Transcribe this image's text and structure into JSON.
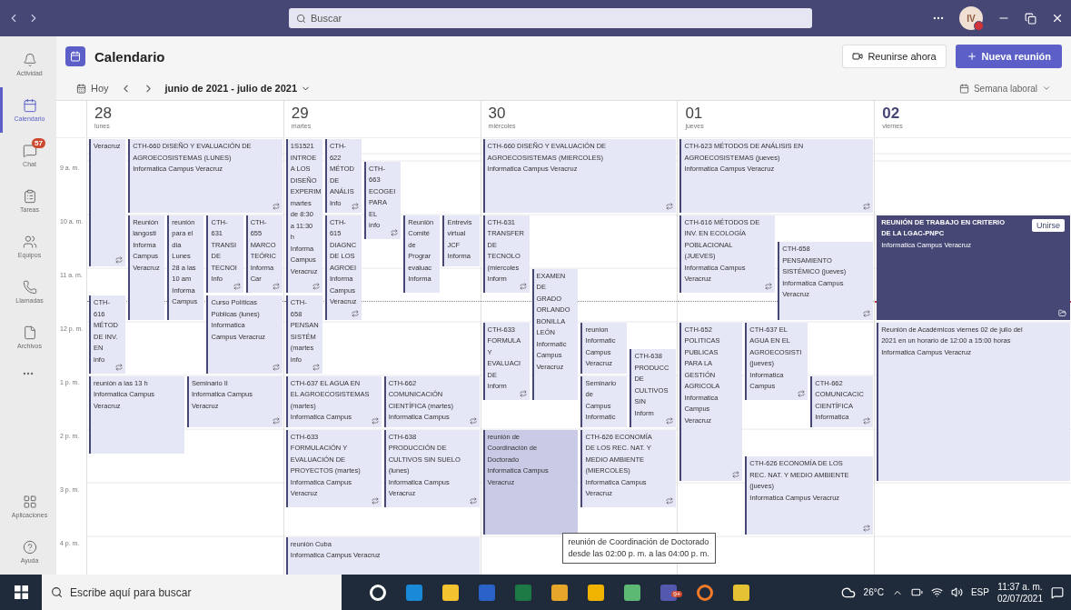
{
  "titlebar": {
    "search_placeholder": "Buscar",
    "avatar_initials": "IV"
  },
  "rail": {
    "items": [
      {
        "label": "Actividad",
        "selected": false
      },
      {
        "label": "Calendario",
        "selected": true
      },
      {
        "label": "Chat",
        "selected": false,
        "badge": "57"
      },
      {
        "label": "Tareas",
        "selected": false
      },
      {
        "label": "Equipos",
        "selected": false
      },
      {
        "label": "Llamadas",
        "selected": false
      },
      {
        "label": "Archivos",
        "selected": false
      }
    ],
    "bottom_items": [
      {
        "label": "Aplicaciones",
        "selected": false
      },
      {
        "label": "Ayuda",
        "selected": false
      }
    ]
  },
  "header": {
    "title": "Calendario",
    "meet_now": "Reunirse ahora",
    "new_meeting": "Nueva reunión"
  },
  "toolbar": {
    "today": "Hoy",
    "range": "junio de 2021 - julio de 2021",
    "view": "Semana laboral"
  },
  "time_labels": [
    "9 a. m.",
    "10 a. m.",
    "11 a. m.",
    "12 p. m.",
    "1 p. m.",
    "2 p. m.",
    "3 p. m.",
    "4 p. m."
  ],
  "days": [
    {
      "number": "28",
      "weekday": "lunes",
      "today": false,
      "events": [
        {
          "kind": "normal",
          "repeat": true,
          "lines": [
            "Veracruz"
          ]
        },
        {
          "kind": "normal",
          "repeat": true,
          "lines": [
            "CTH-660 DISEÑO Y EVALUACIÓN DE",
            "AGROECOSISTEMAS (LUNES)",
            "Informatica Campus Veracruz"
          ]
        },
        {
          "kind": "normal",
          "repeat": false,
          "lines": [
            "Reunión",
            "langosti",
            "Informa",
            "Campus",
            "Veracruz"
          ]
        },
        {
          "kind": "normal",
          "repeat": false,
          "lines": [
            "reunión",
            "para el",
            "dia",
            "Lunes",
            "28 a las",
            "10 am",
            "Informa",
            "Campus"
          ]
        },
        {
          "kind": "normal",
          "repeat": true,
          "lines": [
            "CTH-",
            "631",
            "TRANSI",
            "DE",
            "TECNOI",
            "Info"
          ]
        },
        {
          "kind": "normal",
          "repeat": true,
          "lines": [
            "CTH-",
            "655",
            "MARCO",
            "TEÓRIC",
            "Informa",
            "Car"
          ]
        },
        {
          "kind": "normal",
          "repeat": true,
          "lines": [
            "CTH-",
            "616",
            "MÉTOD",
            "DE INV.",
            "EN",
            "info"
          ]
        },
        {
          "kind": "normal",
          "repeat": true,
          "lines": [
            "Curso Políticas",
            "Públicas (lunes)",
            "Informatica",
            "Campus Veracruz"
          ]
        },
        {
          "kind": "normal",
          "repeat": false,
          "lines": [
            "reunión a las 13 h",
            "Informatica Campus",
            "Veracruz"
          ]
        },
        {
          "kind": "normal",
          "repeat": true,
          "lines": [
            "Seminario II",
            "Informatica Campus",
            "Veracruz"
          ]
        }
      ]
    },
    {
      "number": "29",
      "weekday": "martes",
      "today": false,
      "events": [
        {
          "kind": "normal",
          "repeat": true,
          "lines": [
            "1S1521",
            "INTROE",
            "A LOS",
            "DISEÑO",
            "EXPERIM",
            "martes",
            "de 8:30",
            "a 11:30",
            "h",
            "Informa",
            "Campus",
            "Veracruz"
          ]
        },
        {
          "kind": "normal",
          "repeat": true,
          "lines": [
            "CTH-",
            "622",
            "MÉTOD",
            "DE",
            "ANÁLIS",
            "Info"
          ]
        },
        {
          "kind": "normal",
          "repeat": true,
          "lines": [
            "CTH-",
            "663",
            "ECOGEI",
            "PARA",
            "EL",
            "info"
          ]
        },
        {
          "kind": "normal",
          "repeat": true,
          "lines": [
            "CTH-",
            "615",
            "DIAGNC",
            "DE LOS",
            "AGROEI",
            "Informa",
            "Campus",
            "Veracruz"
          ]
        },
        {
          "kind": "normal",
          "repeat": false,
          "lines": [
            "Reunión",
            "Comité",
            "de",
            "Prograr",
            "evaluac",
            "Informa"
          ]
        },
        {
          "kind": "normal",
          "repeat": false,
          "lines": [
            "Entrevis",
            "virtual",
            "JCF",
            "Informa"
          ]
        },
        {
          "kind": "normal",
          "repeat": true,
          "lines": [
            "CTH-",
            "658",
            "PENSAN",
            "SISTÉM",
            "(martes",
            "info"
          ]
        },
        {
          "kind": "normal",
          "repeat": true,
          "lines": [
            "CTH-637 EL AGUA EN",
            "EL AGROECOSISTEMAS",
            "(martes)",
            "Informatica Campus"
          ]
        },
        {
          "kind": "normal",
          "repeat": true,
          "lines": [
            "CTH-662",
            "COMUNICACIÓN",
            "CIENTÍFICA (martes)",
            "Informatica Campus"
          ]
        },
        {
          "kind": "normal",
          "repeat": true,
          "lines": [
            "CTH-633",
            "FORMULACIÓN Y",
            "EVALUACIÓN DE",
            "PROYECTOS (martes)",
            "Informatica Campus",
            "Veracruz"
          ]
        },
        {
          "kind": "normal",
          "repeat": true,
          "lines": [
            "CTH-638",
            "PRODUCCIÓN DE",
            "CULTIVOS SIN SUELO",
            "(lunes)",
            "Informatica Campus",
            "Veracruz"
          ]
        },
        {
          "kind": "normal",
          "repeat": false,
          "lines": [
            "reunión Cuba",
            "Informatica Campus Veracruz"
          ]
        }
      ]
    },
    {
      "number": "30",
      "weekday": "miércoles",
      "today": false,
      "events": [
        {
          "kind": "normal",
          "repeat": true,
          "lines": [
            "CTH-660 DISEÑO Y EVALUACIÓN DE",
            "AGROECOSISTEMAS (MIERCOLES)",
            "Informatica Campus Veracruz"
          ]
        },
        {
          "kind": "normal",
          "repeat": true,
          "lines": [
            "CTH-631",
            "TRANSFER",
            "DE",
            "TECNOLO",
            "(miercoles",
            "Inform"
          ]
        },
        {
          "kind": "normal",
          "repeat": false,
          "lines": [
            "EXAMEN",
            "DE",
            "GRADO",
            "ORLANDO",
            "BONILLA",
            "LEÓN",
            "Informatic",
            "Campus",
            "Veracruz"
          ]
        },
        {
          "kind": "normal",
          "repeat": true,
          "lines": [
            "CTH-633",
            "FORMULA",
            "Y",
            "EVALUACI",
            "DE",
            "Inform"
          ]
        },
        {
          "kind": "normal",
          "repeat": false,
          "lines": [
            "reunion",
            "Informatic",
            "Campus",
            "Veracruz"
          ]
        },
        {
          "kind": "normal",
          "repeat": true,
          "lines": [
            "CTH-638",
            "PRODUCC",
            "DE",
            "CULTIVOS",
            "SIN",
            "Inform"
          ]
        },
        {
          "kind": "normal",
          "repeat": false,
          "lines": [
            "Seminario",
            "de",
            "Campus",
            "Informatic"
          ]
        },
        {
          "kind": "hovered",
          "repeat": false,
          "lines": [
            "reunión de",
            "Coordinación de",
            "Doctorado",
            "Informatica Campus",
            "Veracruz"
          ],
          "tooltip": [
            "reunión de Coordinación de Doctorado",
            "desde las 02:00 p. m. a las 04:00 p. m."
          ]
        },
        {
          "kind": "normal",
          "repeat": true,
          "lines": [
            "CTH-626 ECONOMÍA",
            "DE LOS REC. NAT. Y",
            "MEDIO AMBIENTE",
            "(MIERCOLES)",
            "Informatica Campus",
            "Veracruz"
          ]
        }
      ]
    },
    {
      "number": "01",
      "weekday": "jueves",
      "today": false,
      "events": [
        {
          "kind": "normal",
          "repeat": true,
          "lines": [
            "CTH-623 MÉTODOS DE ANÁLISIS EN",
            "AGROECOSISTEMAS (jueves)",
            "Informatica Campus Veracruz"
          ]
        },
        {
          "kind": "normal",
          "repeat": true,
          "lines": [
            "CTH-616 MÉTODOS DE",
            "INV. EN ECOLOGÍA",
            "POBLACIONAL",
            "(JUEVES)",
            "Informatica Campus",
            "Veracruz"
          ]
        },
        {
          "kind": "normal",
          "repeat": true,
          "lines": [
            "CTH-658",
            "PENSAMIENTO",
            "SISTÉMICO (jueves)",
            "Informatica Campus",
            "Veracruz"
          ]
        },
        {
          "kind": "normal",
          "repeat": true,
          "lines": [
            "CTH-652",
            "POLITICAS",
            "PUBLICAS",
            "PARA LA",
            "GESTIÓN",
            "AGRICOLA",
            "Informatica",
            "Campus",
            "Veracruz"
          ]
        },
        {
          "kind": "normal",
          "repeat": true,
          "lines": [
            "CTH-637 EL",
            "AGUA EN EL",
            "AGROECOSISTI",
            "(jueves)",
            "Informatica",
            "Campus"
          ]
        },
        {
          "kind": "normal",
          "repeat": true,
          "lines": [
            "CTH-662",
            "COMUNICACIC",
            "CIENTÍFICA",
            "Informatica"
          ]
        },
        {
          "kind": "normal",
          "repeat": true,
          "lines": [
            "CTH-626 ECONOMÍA DE LOS",
            "REC. NAT. Y MEDIO AMBIENTE",
            "(jueves)",
            "Informatica Campus Veracruz"
          ]
        }
      ]
    },
    {
      "number": "02",
      "weekday": "viernes",
      "today": true,
      "events": [
        {
          "kind": "live",
          "repeat": false,
          "lines": [
            "REUNIÓN DE TRABAJO EN CRITERIO",
            "DE LA LGAC-PNPC",
            "Informatica Campus Veracruz"
          ],
          "join": "Unirse"
        },
        {
          "kind": "normal",
          "repeat": false,
          "lines": [
            "Reunión de Académicos viernes 02 de julio del",
            "2021 en un horario de 12:00 a 15:00 horas",
            "Informatica Campus Veracruz"
          ]
        }
      ]
    }
  ],
  "taskbar": {
    "search_placeholder": "Escribe aquí para buscar",
    "apps": [
      {
        "kind": "ring",
        "color": "#ffffff"
      },
      {
        "kind": "tile",
        "color": "#1a8ad8"
      },
      {
        "kind": "tile",
        "color": "#f2c230"
      },
      {
        "kind": "tile",
        "color": "#2b62c9"
      },
      {
        "kind": "tile",
        "color": "#1d7a45"
      },
      {
        "kind": "tile",
        "color": "#e8a52c"
      },
      {
        "kind": "tile",
        "color": "#f0b400"
      },
      {
        "kind": "tile",
        "color": "#5bb974"
      },
      {
        "kind": "tile",
        "color": "#5558af",
        "badge": "9+"
      },
      {
        "kind": "ring",
        "color": "#f07c2a"
      },
      {
        "kind": "tile",
        "color": "#e5c234"
      }
    ],
    "temperature": "26°C",
    "language": "ESP",
    "time": "11:37 a. m.",
    "date": "02/07/2021"
  }
}
